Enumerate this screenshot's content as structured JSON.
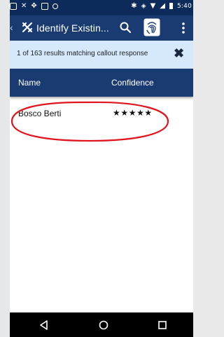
{
  "status_bar": {
    "time": "5:40",
    "left_icons": [
      "image-icon",
      "app-logo-icon",
      "sync-icon",
      "photo-icon",
      "camera-icon"
    ],
    "right_icons": [
      "bluetooth-icon",
      "vibrate-icon",
      "wifi-icon",
      "signal-icon",
      "battery-icon"
    ]
  },
  "app_bar": {
    "title": "Identify Existin...",
    "back_glyph": "‹",
    "icons": [
      "app-logo-icon",
      "search-icon",
      "fingerprint-icon",
      "overflow-menu-icon"
    ]
  },
  "banner": {
    "text": "1 of 163 results matching callout response",
    "close_glyph": "✖"
  },
  "table": {
    "headers": [
      "Name",
      "Confidence"
    ],
    "rows": [
      {
        "name": "Bosco Berti",
        "confidence": "★★★★★",
        "confidence_stars": 5
      }
    ]
  },
  "nav_bar": {
    "buttons": [
      "back-icon",
      "home-icon",
      "recents-icon"
    ]
  },
  "colors": {
    "status_bar": "#0d2b5a",
    "app_bar": "#1a3b72",
    "banner": "#d6e8fb",
    "table_header": "#1a3b72",
    "highlight_circle": "#e0141c",
    "nav_bar": "#000000"
  }
}
